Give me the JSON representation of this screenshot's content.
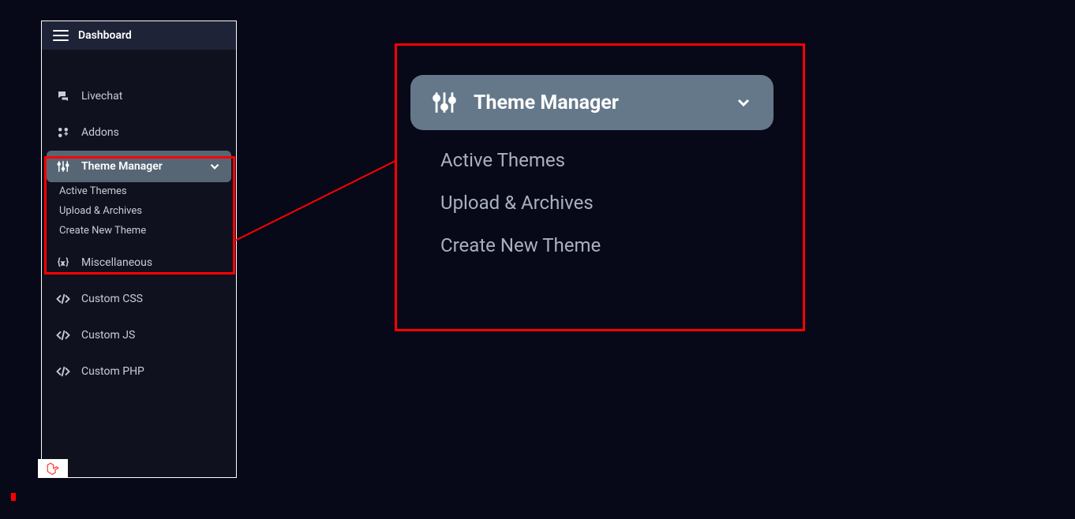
{
  "sidebar": {
    "header": {
      "title": "Dashboard"
    },
    "items": [
      {
        "icon": "chat",
        "label": "Livechat"
      },
      {
        "icon": "addons",
        "label": "Addons"
      },
      {
        "icon": "sliders",
        "label": "Theme Manager"
      },
      {
        "icon": "braces",
        "label": "Miscellaneous"
      },
      {
        "icon": "code",
        "label": "Custom CSS"
      },
      {
        "icon": "code",
        "label": "Custom JS"
      },
      {
        "icon": "code",
        "label": "Custom PHP"
      }
    ],
    "theme_manager_sub": [
      "Active Themes",
      "Upload & Archives",
      "Create New Theme"
    ]
  },
  "zoom": {
    "title": "Theme Manager",
    "items": [
      "Active Themes",
      "Upload & Archives",
      "Create New Theme"
    ]
  }
}
